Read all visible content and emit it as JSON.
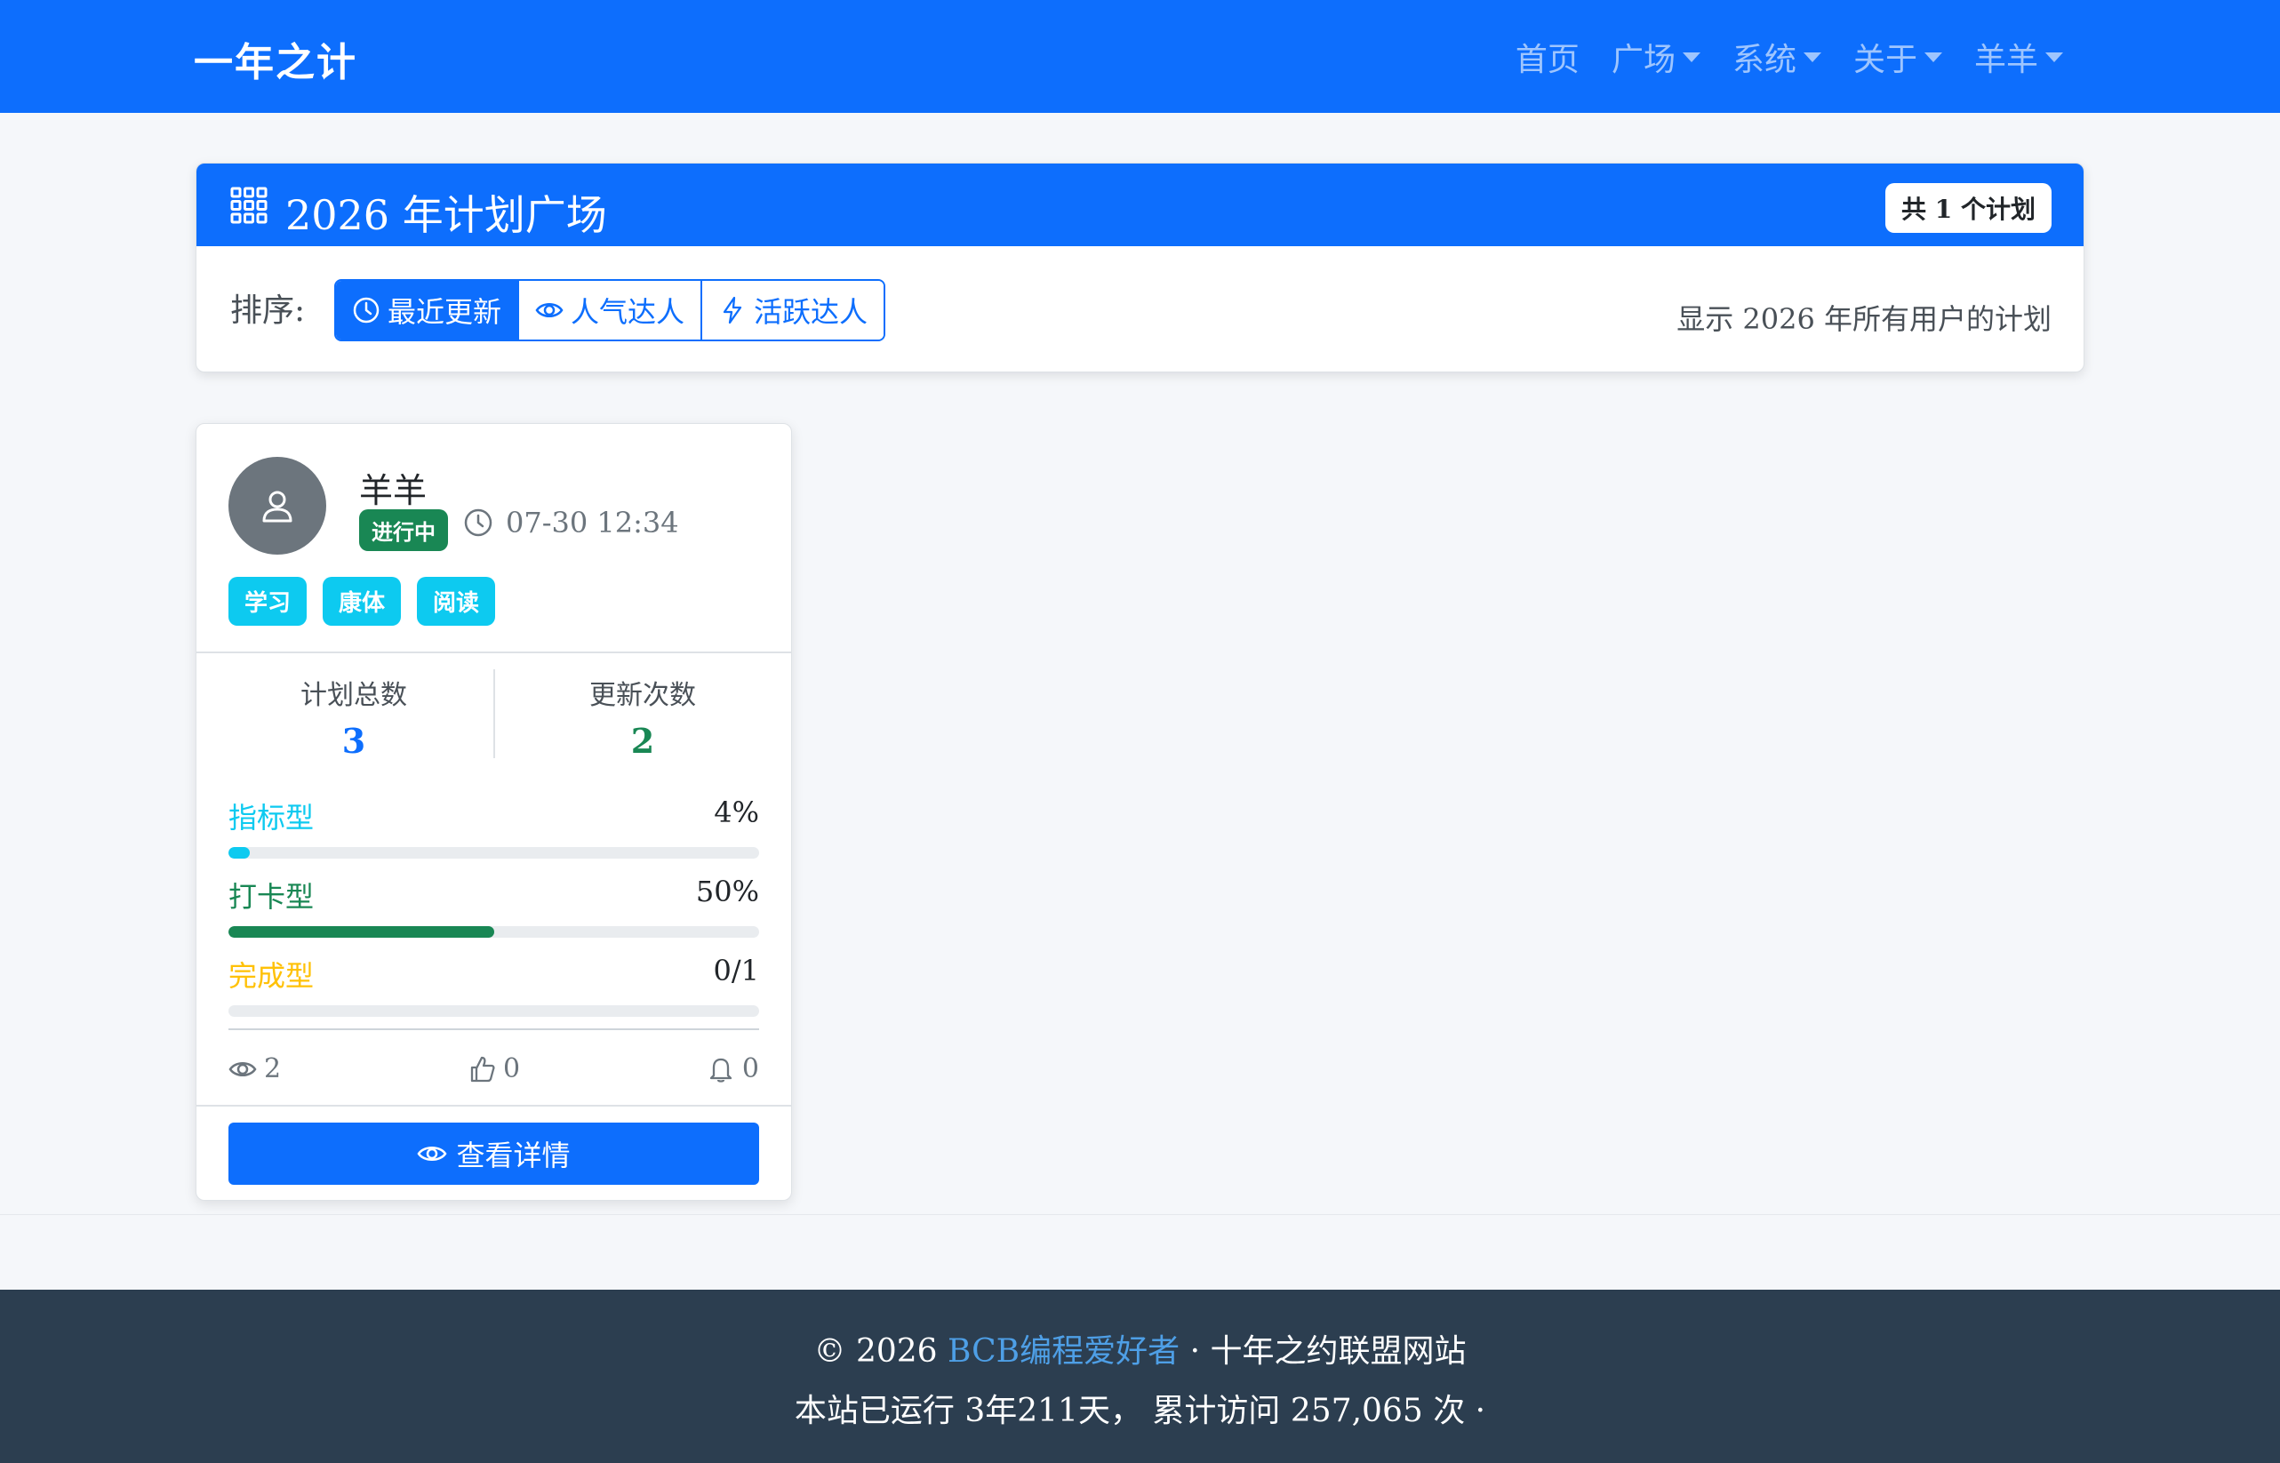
{
  "navbar": {
    "brand": "一年之计",
    "items": [
      {
        "label": "首页",
        "dropdown": false
      },
      {
        "label": "广场",
        "dropdown": true
      },
      {
        "label": "系统",
        "dropdown": true
      },
      {
        "label": "关于",
        "dropdown": true
      },
      {
        "label": "羊羊",
        "dropdown": true
      }
    ]
  },
  "plaza": {
    "title": "2026 年计划广场",
    "count_badge": "共 1 个计划",
    "sort_label": "排序:",
    "sort_options": [
      {
        "label": "最近更新",
        "icon": "clock-icon",
        "active": true
      },
      {
        "label": "人气达人",
        "icon": "eye-icon",
        "active": false
      },
      {
        "label": "活跃达人",
        "icon": "lightning-icon",
        "active": false
      }
    ],
    "description": "显示 2026 年所有用户的计划"
  },
  "card": {
    "username": "羊羊",
    "status": "进行中",
    "time": "07-30 12:34",
    "tags": [
      "学习",
      "康体",
      "阅读"
    ],
    "stats": [
      {
        "label": "计划总数",
        "value": "3",
        "color": "#0d6efd"
      },
      {
        "label": "更新次数",
        "value": "2",
        "color": "#198754"
      }
    ],
    "progress": [
      {
        "label": "指标型",
        "value": "4%",
        "fraction": 0.04,
        "color": "#0dcaf0"
      },
      {
        "label": "打卡型",
        "value": "50%",
        "fraction": 0.5,
        "color": "#198754"
      },
      {
        "label": "完成型",
        "value": "0/1",
        "fraction": 0,
        "color": "#ffc107"
      }
    ],
    "views": "2",
    "likes": "0",
    "reminders": "0",
    "detail_button": "查看详情"
  },
  "footer": {
    "copyright": "© 2026",
    "site_link": "BCB编程爱好者",
    "alliance": "· 十年之约联盟网站",
    "running_prefix": "本站已运行",
    "running_value": "3年211天，",
    "visits_prefix": "累计访问",
    "visits_value": "257,065",
    "visits_suffix": "次 ·"
  },
  "colors": {
    "primary": "#0d6efd",
    "footer_bg": "#2c3e50",
    "success": "#198754",
    "info": "#0dcaf0",
    "warning": "#ffc107"
  }
}
